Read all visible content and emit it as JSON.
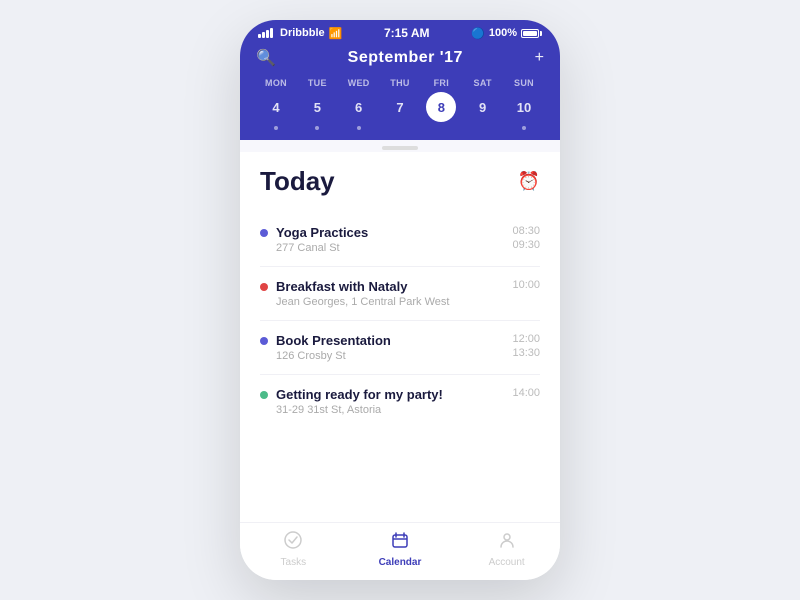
{
  "statusBar": {
    "carrier": "Dribbble",
    "time": "7:15 AM",
    "battery": "100%"
  },
  "header": {
    "searchIcon": "🔍",
    "title": "September '17",
    "addIcon": "+",
    "days": [
      {
        "name": "MON",
        "num": "4",
        "dot": true,
        "active": false
      },
      {
        "name": "TUE",
        "num": "5",
        "dot": true,
        "active": false
      },
      {
        "name": "WED",
        "num": "6",
        "dot": true,
        "active": false
      },
      {
        "name": "THU",
        "num": "7",
        "dot": false,
        "active": false
      },
      {
        "name": "FRI",
        "num": "8",
        "dot": false,
        "active": true
      },
      {
        "name": "SAT",
        "num": "9",
        "dot": false,
        "active": false
      },
      {
        "name": "SUN",
        "num": "10",
        "dot": true,
        "active": false
      }
    ]
  },
  "main": {
    "todayLabel": "Today",
    "events": [
      {
        "color": "#5b5bd6",
        "title": "Yoga Practices",
        "location": "277 Canal St",
        "timeStart": "08:30",
        "timeEnd": "09:30"
      },
      {
        "color": "#e04444",
        "title": "Breakfast with Nataly",
        "location": "Jean Georges, 1 Central Park West",
        "timeStart": "10:00",
        "timeEnd": ""
      },
      {
        "color": "#5b5bd6",
        "title": "Book Presentation",
        "location": "126 Crosby St",
        "timeStart": "12:00",
        "timeEnd": "13:30"
      },
      {
        "color": "#4cbb89",
        "title": "Getting ready for my party!",
        "location": "31-29 31st St, Astoria",
        "timeStart": "14:00",
        "timeEnd": ""
      }
    ]
  },
  "bottomNav": [
    {
      "icon": "✓",
      "label": "Tasks",
      "active": false,
      "name": "tasks"
    },
    {
      "icon": "📅",
      "label": "Calendar",
      "active": true,
      "name": "calendar"
    },
    {
      "icon": "👤",
      "label": "Account",
      "active": false,
      "name": "account"
    }
  ]
}
